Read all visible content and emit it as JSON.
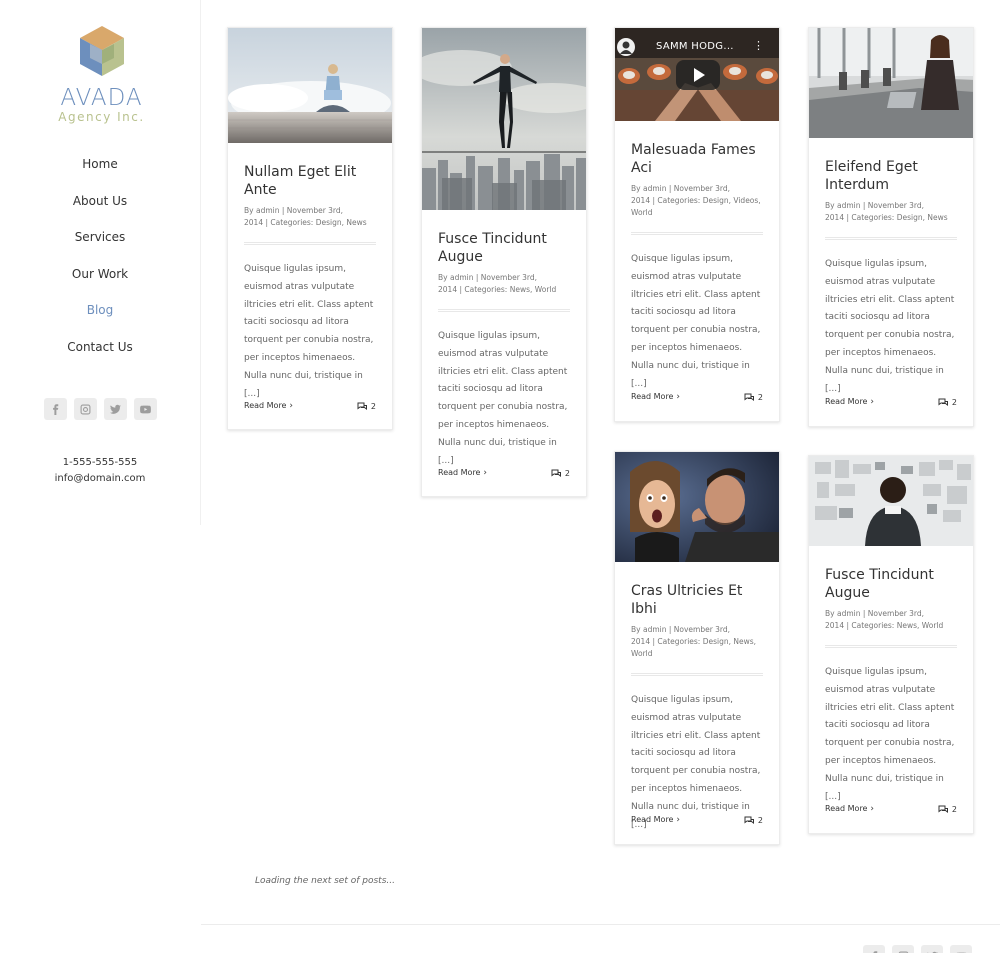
{
  "brand": {
    "name": "AVADA",
    "tagline": "Agency Inc."
  },
  "nav": [
    "Home",
    "About Us",
    "Services",
    "Our Work",
    "Blog",
    "Contact Us"
  ],
  "nav_active": "Blog",
  "social_icons": [
    "facebook-icon",
    "instagram-icon",
    "twitter-icon",
    "youtube-icon"
  ],
  "contact": {
    "phone": "1-555-555-555",
    "email": "info@domain.com"
  },
  "posts": [
    {
      "title": "Nullam Eget Elit Ante",
      "meta_line1": "By admin | November 3rd,",
      "meta_line2": "2014 | Categories: Design, News",
      "excerpt": "Quisque ligulas ipsum, euismod atras vulputate iltricies etri elit. Class aptent taciti sociosqu ad litora torquent per conubia nostra, per inceptos himenaeos. Nulla nunc dui, tristique in [...]",
      "read_more": "Read More",
      "comments": "2",
      "image": "woman-laptop-clouds"
    },
    {
      "title": "Fusce Tincidunt Augue",
      "meta_line1": "By admin | November 3rd,",
      "meta_line2": "2014 | Categories: News, World",
      "excerpt": "Quisque ligulas ipsum, euismod atras vulputate iltricies etri elit. Class aptent taciti sociosqu ad litora torquent per conubia nostra, per inceptos himenaeos. Nulla nunc dui, tristique in [...]",
      "read_more": "Read More",
      "comments": "2",
      "image": "businessman-tightrope"
    },
    {
      "title": "Malesuada Fames Aci",
      "meta_line1": "By admin | November 3rd,",
      "meta_line2": "2014 | Categories: Design, Videos,",
      "meta_line3": "World",
      "video_title": "SAMM HODG...",
      "excerpt": "Quisque ligulas ipsum, euismod atras vulputate iltricies etri elit. Class aptent taciti sociosqu ad litora torquent per conubia nostra, per inceptos himenaeos. Nulla nunc dui, tristique in [...]",
      "read_more": "Read More",
      "comments": "2",
      "image": "video-thumbnail"
    },
    {
      "title": "Eleifend Eget Interdum",
      "meta_line1": "By admin | November 3rd,",
      "meta_line2": "2014 | Categories: Design, News",
      "excerpt": "Quisque ligulas ipsum, euismod atras vulputate iltricies etri elit. Class aptent taciti sociosqu ad litora torquent per conubia nostra, per inceptos himenaeos. Nulla nunc dui, tristique in [...]",
      "read_more": "Read More",
      "comments": "2",
      "image": "woman-office-laptop"
    },
    {
      "title": "Cras Ultricies Et Ibhi",
      "meta_line1": "By admin | November 3rd,",
      "meta_line2": "2014 | Categories: Design, News,",
      "meta_line3": "World",
      "excerpt": "Quisque ligulas ipsum, euismod atras vulputate iltricies etri elit. Class aptent taciti sociosqu ad litora torquent per conubia nostra, per inceptos himenaeos. Nulla nunc dui, tristique in [...]",
      "read_more": "Read More",
      "comments": "2",
      "image": "whisper-surprise"
    },
    {
      "title": "Fusce Tincidunt Augue",
      "meta_line1": "By admin | November 3rd,",
      "meta_line2": "2014 | Categories: News, World",
      "excerpt": "Quisque ligulas ipsum, euismod atras vulputate iltricies etri elit. Class aptent taciti sociosqu ad litora torquent per conubia nostra, per inceptos himenaeos. Nulla nunc dui, tristique in [...]",
      "read_more": "Read More",
      "comments": "2",
      "image": "man-moodboard"
    }
  ],
  "loading_text": "Loading the next set of posts...",
  "colors": {
    "accent": "#6d8fbd",
    "logo_green": "#b9c28f",
    "text": "#333333"
  }
}
